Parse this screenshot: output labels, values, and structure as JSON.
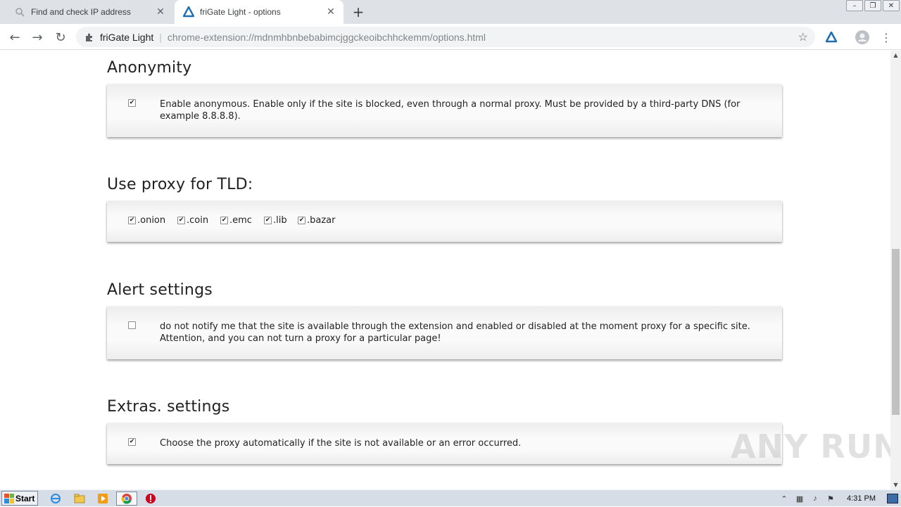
{
  "tabs": [
    {
      "title": "Find and check IP address",
      "active": false
    },
    {
      "title": "friGate Light - options",
      "active": true
    }
  ],
  "omnibox": {
    "site": "friGate Light",
    "url": "chrome-extension://mdnmhbnbebabimcjggckeoibchhckemm/options.html"
  },
  "sections": {
    "anonymity": {
      "title": "Anonymity",
      "checked": true,
      "text": "Enable anonymous. Enable only if the site is blocked, even through a normal proxy. Must be provided by a third-party DNS (for example 8.8.8.8)."
    },
    "tld": {
      "title": "Use proxy for TLD:",
      "items": [
        {
          "label": ".onion",
          "checked": true
        },
        {
          "label": ".coin",
          "checked": true
        },
        {
          "label": ".emc",
          "checked": true
        },
        {
          "label": ".lib",
          "checked": true
        },
        {
          "label": ".bazar",
          "checked": true
        }
      ]
    },
    "alert": {
      "title": "Alert settings",
      "checked": false,
      "text": "do not notify me that the site is available through the extension and enabled or disabled at the moment proxy for a specific site. Attention, and you can not turn a proxy for a particular page!"
    },
    "extras": {
      "title": "Extras. settings",
      "checked": true,
      "text": "Choose the proxy automatically if the site is not available or an error occurred."
    }
  },
  "watermark": "ANY RUN",
  "taskbar": {
    "start_label": "Start",
    "clock": "4:31 PM"
  },
  "colors": {
    "frigate_accent": "#1f6fb2",
    "tabstrip": "#dee1e6"
  }
}
